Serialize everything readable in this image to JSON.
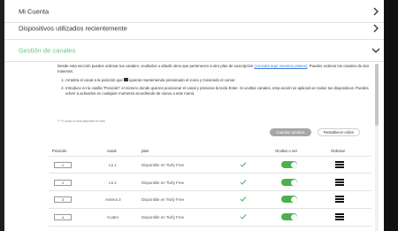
{
  "accordion": [
    {
      "label": "Mi Cuenta",
      "icon": "chevron-right-icon"
    },
    {
      "label": "Dispositivos utilizados recientemente",
      "icon": "chevron-right-icon"
    },
    {
      "label": "Gestión de canales",
      "icon": "chevron-down-icon",
      "active": true,
      "color": "#6ac58b"
    }
  ],
  "intro": {
    "text": "Desde esta sección puedes ordenar tus canales, ocultarlos o añadir otros que pertenecen a otro plan de suscripción",
    "link": "(consulta aquí nuestros planes)",
    "text2": ". Puedes ordenar los canales de dos maneras:",
    "step1a": "Arrastra el canal a la posición que",
    "step1b": "quieras manteniendo presionado el icono y moviendo el cursor.",
    "step2": "Introduce en la casilla \"Posición\" el número donde quieres posicionar el canal y presiona la tecla Enter. Si ocultas canales, esta acción se aplicará en todos tus dispositivos. Puedes volver a activarlos en cualquier momento accediendo de nuevo a este menú.",
    "note": "*** El canal no está disponible en web"
  },
  "buttons": {
    "save": "Guardar cambios",
    "reset": "Restablecer orden"
  },
  "table": {
    "headers": {
      "position": "Posición",
      "channel": "canal",
      "plan": "plan",
      "hide": "Ocultar o ver",
      "order": "Ordenar"
    },
    "rows": [
      {
        "position": "1",
        "channel": "La 1",
        "plan": "Disponible en Tivify Free",
        "available": true,
        "visible": true
      },
      {
        "position": "2",
        "channel": "La 2",
        "plan": "Disponible en Tivify Free",
        "available": true,
        "visible": true
      },
      {
        "position": "3",
        "channel": "Antena 3",
        "plan": "Disponible en Tivify Free",
        "available": true,
        "visible": true
      },
      {
        "position": "4",
        "channel": "Cuatro",
        "plan": "Disponible en Tivify Free",
        "available": true,
        "visible": true
      }
    ]
  },
  "colors": {
    "accent": "#6ac58b",
    "toggle_on": "#4caf50",
    "link": "#3a7bd5"
  }
}
